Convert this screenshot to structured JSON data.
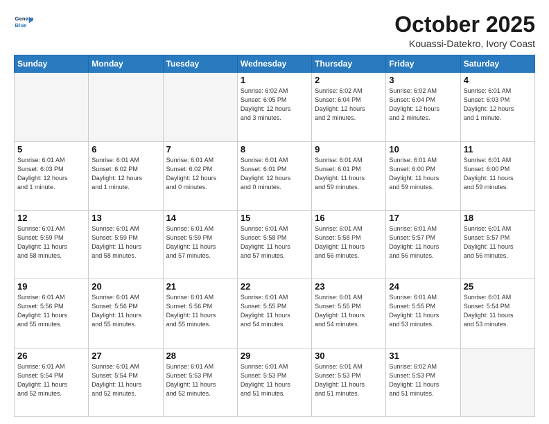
{
  "header": {
    "logo_line1": "General",
    "logo_line2": "Blue",
    "month": "October 2025",
    "location": "Kouassi-Datekro, Ivory Coast"
  },
  "days_of_week": [
    "Sunday",
    "Monday",
    "Tuesday",
    "Wednesday",
    "Thursday",
    "Friday",
    "Saturday"
  ],
  "weeks": [
    [
      {
        "day": "",
        "info": ""
      },
      {
        "day": "",
        "info": ""
      },
      {
        "day": "",
        "info": ""
      },
      {
        "day": "1",
        "info": "Sunrise: 6:02 AM\nSunset: 6:05 PM\nDaylight: 12 hours\nand 3 minutes."
      },
      {
        "day": "2",
        "info": "Sunrise: 6:02 AM\nSunset: 6:04 PM\nDaylight: 12 hours\nand 2 minutes."
      },
      {
        "day": "3",
        "info": "Sunrise: 6:02 AM\nSunset: 6:04 PM\nDaylight: 12 hours\nand 2 minutes."
      },
      {
        "day": "4",
        "info": "Sunrise: 6:01 AM\nSunset: 6:03 PM\nDaylight: 12 hours\nand 1 minute."
      }
    ],
    [
      {
        "day": "5",
        "info": "Sunrise: 6:01 AM\nSunset: 6:03 PM\nDaylight: 12 hours\nand 1 minute."
      },
      {
        "day": "6",
        "info": "Sunrise: 6:01 AM\nSunset: 6:02 PM\nDaylight: 12 hours\nand 1 minute."
      },
      {
        "day": "7",
        "info": "Sunrise: 6:01 AM\nSunset: 6:02 PM\nDaylight: 12 hours\nand 0 minutes."
      },
      {
        "day": "8",
        "info": "Sunrise: 6:01 AM\nSunset: 6:01 PM\nDaylight: 12 hours\nand 0 minutes."
      },
      {
        "day": "9",
        "info": "Sunrise: 6:01 AM\nSunset: 6:01 PM\nDaylight: 11 hours\nand 59 minutes."
      },
      {
        "day": "10",
        "info": "Sunrise: 6:01 AM\nSunset: 6:00 PM\nDaylight: 11 hours\nand 59 minutes."
      },
      {
        "day": "11",
        "info": "Sunrise: 6:01 AM\nSunset: 6:00 PM\nDaylight: 11 hours\nand 59 minutes."
      }
    ],
    [
      {
        "day": "12",
        "info": "Sunrise: 6:01 AM\nSunset: 5:59 PM\nDaylight: 11 hours\nand 58 minutes."
      },
      {
        "day": "13",
        "info": "Sunrise: 6:01 AM\nSunset: 5:59 PM\nDaylight: 11 hours\nand 58 minutes."
      },
      {
        "day": "14",
        "info": "Sunrise: 6:01 AM\nSunset: 5:59 PM\nDaylight: 11 hours\nand 57 minutes."
      },
      {
        "day": "15",
        "info": "Sunrise: 6:01 AM\nSunset: 5:58 PM\nDaylight: 11 hours\nand 57 minutes."
      },
      {
        "day": "16",
        "info": "Sunrise: 6:01 AM\nSunset: 5:58 PM\nDaylight: 11 hours\nand 56 minutes."
      },
      {
        "day": "17",
        "info": "Sunrise: 6:01 AM\nSunset: 5:57 PM\nDaylight: 11 hours\nand 56 minutes."
      },
      {
        "day": "18",
        "info": "Sunrise: 6:01 AM\nSunset: 5:57 PM\nDaylight: 11 hours\nand 56 minutes."
      }
    ],
    [
      {
        "day": "19",
        "info": "Sunrise: 6:01 AM\nSunset: 5:56 PM\nDaylight: 11 hours\nand 55 minutes."
      },
      {
        "day": "20",
        "info": "Sunrise: 6:01 AM\nSunset: 5:56 PM\nDaylight: 11 hours\nand 55 minutes."
      },
      {
        "day": "21",
        "info": "Sunrise: 6:01 AM\nSunset: 5:56 PM\nDaylight: 11 hours\nand 55 minutes."
      },
      {
        "day": "22",
        "info": "Sunrise: 6:01 AM\nSunset: 5:55 PM\nDaylight: 11 hours\nand 54 minutes."
      },
      {
        "day": "23",
        "info": "Sunrise: 6:01 AM\nSunset: 5:55 PM\nDaylight: 11 hours\nand 54 minutes."
      },
      {
        "day": "24",
        "info": "Sunrise: 6:01 AM\nSunset: 5:55 PM\nDaylight: 11 hours\nand 53 minutes."
      },
      {
        "day": "25",
        "info": "Sunrise: 6:01 AM\nSunset: 5:54 PM\nDaylight: 11 hours\nand 53 minutes."
      }
    ],
    [
      {
        "day": "26",
        "info": "Sunrise: 6:01 AM\nSunset: 5:54 PM\nDaylight: 11 hours\nand 52 minutes."
      },
      {
        "day": "27",
        "info": "Sunrise: 6:01 AM\nSunset: 5:54 PM\nDaylight: 11 hours\nand 52 minutes."
      },
      {
        "day": "28",
        "info": "Sunrise: 6:01 AM\nSunset: 5:53 PM\nDaylight: 11 hours\nand 52 minutes."
      },
      {
        "day": "29",
        "info": "Sunrise: 6:01 AM\nSunset: 5:53 PM\nDaylight: 11 hours\nand 51 minutes."
      },
      {
        "day": "30",
        "info": "Sunrise: 6:01 AM\nSunset: 5:53 PM\nDaylight: 11 hours\nand 51 minutes."
      },
      {
        "day": "31",
        "info": "Sunrise: 6:02 AM\nSunset: 5:53 PM\nDaylight: 11 hours\nand 51 minutes."
      },
      {
        "day": "",
        "info": ""
      }
    ]
  ]
}
